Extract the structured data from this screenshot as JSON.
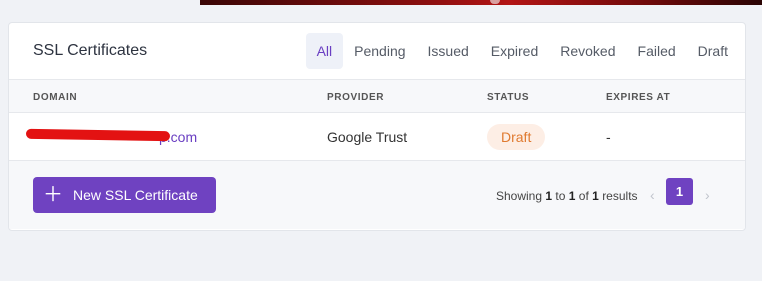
{
  "card": {
    "title": "SSL Certificates",
    "tabs": [
      {
        "label": "All",
        "active": true
      },
      {
        "label": "Pending"
      },
      {
        "label": "Issued"
      },
      {
        "label": "Expired"
      },
      {
        "label": "Revoked"
      },
      {
        "label": "Failed"
      },
      {
        "label": "Draft"
      }
    ]
  },
  "table": {
    "columns": [
      "DOMAIN",
      "PROVIDER",
      "STATUS",
      "EXPIRES AT"
    ],
    "rows": [
      {
        "domain_suffix": "p.com",
        "provider": "Google Trust",
        "status": "Draft",
        "expires_at": "-"
      }
    ]
  },
  "footer": {
    "new_button_label": "New SSL Certificate",
    "showing_prefix": "Showing",
    "from": "1",
    "to_word": "to",
    "to": "1",
    "of_word": "of",
    "total": "1",
    "results_word": "results",
    "current_page": "1",
    "prev_glyph": "‹",
    "next_glyph": "›"
  },
  "colors": {
    "accent": "#6f42c1",
    "draft_badge_bg": "#fdeee5",
    "draft_badge_text": "#e07a30",
    "redaction": "#e31212"
  },
  "icons": [
    "plus-icon",
    "chevron-left-icon",
    "chevron-right-icon"
  ]
}
